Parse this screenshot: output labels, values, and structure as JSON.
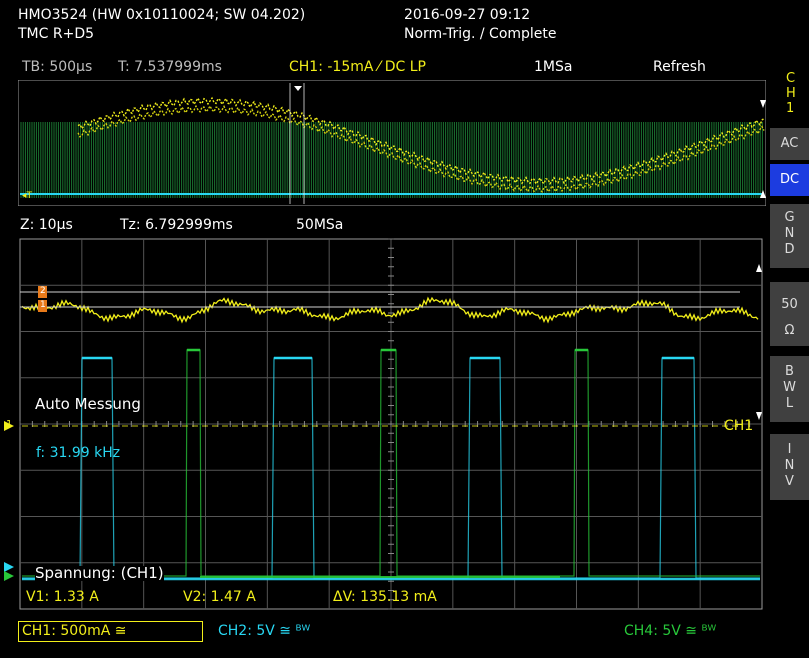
{
  "header": {
    "device": "HMO3524 (HW 0x10110024; SW 04.202)",
    "interface": "TMC R+D5",
    "datetime": "2016-09-27 09:12",
    "trigger_mode": "Norm-Trig. / Complete"
  },
  "overview_bar": {
    "timebase": "TB: 500µs",
    "trigger_time": "T: 7.537999ms",
    "channel_setting": "CH1: -15mA ⁄ DC LP",
    "sample_rate": "1MSa",
    "mode": "Refresh"
  },
  "zoom_bar": {
    "zoom": "Z: 10µs",
    "zoom_time": "Tz: 6.792999ms",
    "sample_rate": "50MSa"
  },
  "side_panel": {
    "channel_label": [
      "C",
      "H",
      "1"
    ],
    "buttons": [
      {
        "label": "AC",
        "active": false
      },
      {
        "label": "DC",
        "active": true
      },
      {
        "label": "G\nN\nD",
        "active": false
      },
      {
        "label": "50\nΩ",
        "active": false
      },
      {
        "label": "B\nW\nL",
        "active": false
      },
      {
        "label": "I\nN\nV",
        "active": false
      }
    ]
  },
  "measurements": {
    "title": "Auto Messung",
    "frequency": "f: 31.99 kHz",
    "voltage_title": "Spannung: (CH1)",
    "v1": "V1: 1.33 A",
    "v2": "V2: 1.47 A",
    "delta_v": "ΔV: 135.13 mA"
  },
  "markers": {
    "ch1_level": "CH1",
    "ref_left": "1",
    "cursor1": "1",
    "cursor2": "2"
  },
  "footer": {
    "ch1": "CH1: 500mA ≅",
    "ch2": "CH2: 5V ≅ ᴮᵂ",
    "ch4": "CH4: 5V ≅ ᴮᵂ"
  },
  "colors": {
    "ch1": "#f2ef1a",
    "ch2": "#28d7f2",
    "ch4": "#28c83a",
    "active_button": "#1c3ce0"
  }
}
